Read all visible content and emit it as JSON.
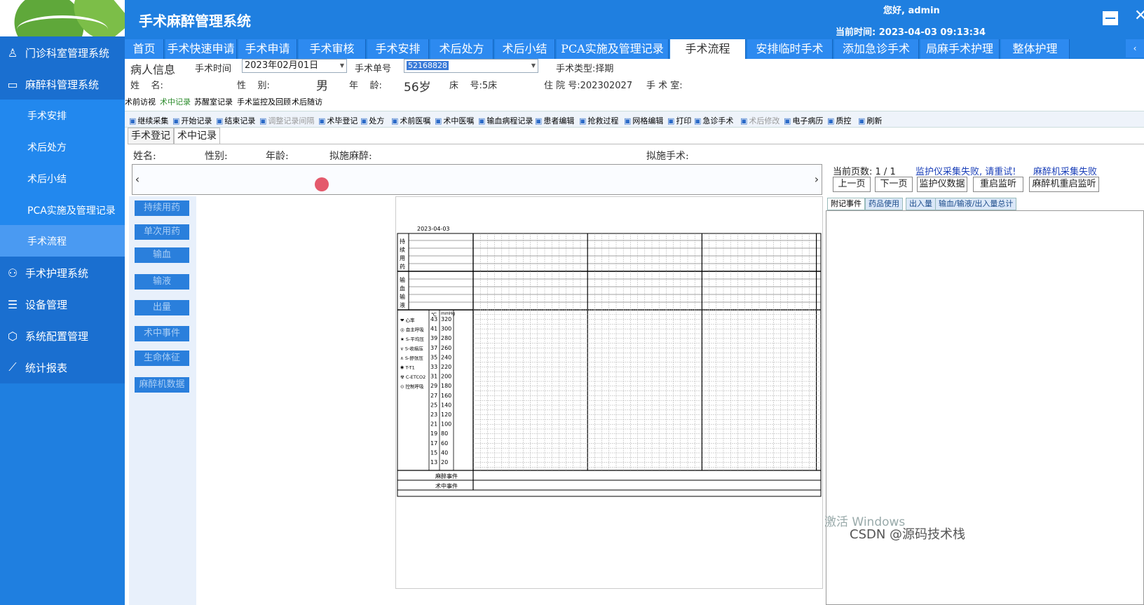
{
  "app": {
    "title": "手术麻醉管理系统",
    "greeting": "您好, admin",
    "time_label": "当前时间:",
    "time_value": "2023-04-03 09:13:34"
  },
  "sidebar": [
    {
      "label": "门诊科室管理系统",
      "icon": "ward-icon",
      "type": "top"
    },
    {
      "label": "麻醉科管理系统",
      "icon": "monitor-icon",
      "type": "top"
    },
    {
      "label": "手术安排",
      "type": "sub"
    },
    {
      "label": "术后处方",
      "type": "sub"
    },
    {
      "label": "术后小结",
      "type": "sub"
    },
    {
      "label": "PCA实施及管理记录",
      "type": "sub"
    },
    {
      "label": "手术流程",
      "type": "sub",
      "active": true
    },
    {
      "label": "手术护理系统",
      "icon": "nursing-icon",
      "type": "top"
    },
    {
      "label": "设备管理",
      "icon": "device-icon",
      "type": "top"
    },
    {
      "label": "系统配置管理",
      "icon": "cube-icon",
      "type": "top"
    },
    {
      "label": "统计报表",
      "icon": "chart-icon",
      "type": "top"
    }
  ],
  "tabs": [
    "首页",
    "手术快速申请",
    "手术申请",
    "手术审核",
    "手术安排",
    "术后处方",
    "术后小结",
    "PCA实施及管理记录",
    "手术流程",
    "安排临时手术",
    "添加急诊手术",
    "局麻手术护理",
    "整体护理"
  ],
  "active_tab": "手术流程",
  "patient_info": {
    "section_title": "病人信息",
    "surgery_time_label": "手术时间",
    "surgery_time_value": "2023年02月01日",
    "surgery_no_label": "手术单号",
    "surgery_no_value": "52168828",
    "surgery_type_label": "手术类型:择期",
    "name_label": "姓    名:",
    "gender_label": "性    别:",
    "gender_value": "男",
    "age_label": "年    龄:",
    "age_value": "56岁",
    "bed_label": "床    号:5床",
    "hospital_no_label": "住 院 号:202302027",
    "room_label": "手 术 室:"
  },
  "subtabs": [
    "术前访视",
    "术中记录",
    "苏醒室记录",
    "手术监控及回顾",
    "术后随访"
  ],
  "toolbar": [
    "继续采集",
    "开始记录",
    "结束记录",
    "调整记录间隔",
    "术毕登记",
    "处方",
    "术前医嘱",
    "术中医嘱",
    "输血病程记录",
    "患者编辑",
    "抢救过程",
    "网格编辑",
    "打印",
    "急诊手术",
    "术后修改",
    "电子病历",
    "质控",
    "刷新"
  ],
  "record_tabs": [
    "手术登记",
    "术中记录"
  ],
  "record_header": {
    "name": "姓名:",
    "gender": "性别:",
    "age": "年龄:",
    "anesthesia": "拟施麻醉:",
    "surgery": "拟施手术:"
  },
  "side_buttons": [
    "持续用药",
    "单次用药",
    "输血",
    "输液",
    "出量",
    "术中事件",
    "生命体征",
    "麻醉机数据"
  ],
  "chart": {
    "date": "2023-04-03",
    "sec1": [
      "持",
      "续",
      "用",
      "药"
    ],
    "sec2": [
      "输",
      "血",
      "输",
      "液"
    ],
    "unit_c": "℃",
    "unit_mmhg": "mmHg",
    "celsius": [
      "43",
      "41",
      "39",
      "37",
      "35",
      "33",
      "31",
      "29",
      "27",
      "25",
      "23",
      "21",
      "19",
      "17",
      "15",
      "13"
    ],
    "mmhg": [
      "320",
      "300",
      "280",
      "260",
      "240",
      "220",
      "200",
      "180",
      "160",
      "140",
      "120",
      "100",
      "80",
      "60",
      "40",
      "20"
    ],
    "legend": [
      "❤ 心率",
      "◎ 自主呼吸",
      "★ S-平均压",
      "∨ S-收缩压",
      "∧ S-舒张压",
      "✱ T-T1",
      "☢ C-ETCO2",
      "⊙ 控制呼吸"
    ],
    "row_anes": "麻醉事件",
    "row_intraop": "术中事件"
  },
  "right": {
    "page_label": "当前页数:",
    "page_value": "1 / 1",
    "monitor_error": "监护仪采集失败, 请重试!",
    "anes_error": "麻醉机采集失败",
    "buttons": [
      "上一页",
      "下一页",
      "监护仪数据",
      "重启监听",
      "麻醉机重启监听"
    ],
    "tabs": [
      "附记事件",
      "药品使用",
      "出入量",
      "输血/输液/出入量总计"
    ]
  },
  "watermark": {
    "line1": "激活 Windows",
    "line2": "CSDN @源码技术栈"
  }
}
